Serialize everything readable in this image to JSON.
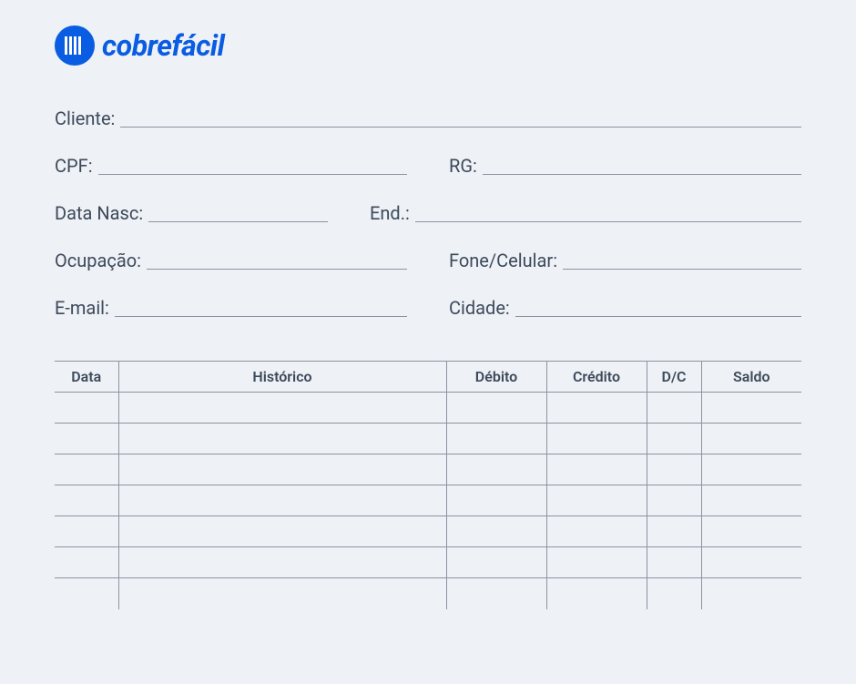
{
  "brand": {
    "name": "cobrefácil",
    "accent": "#0a5ce2"
  },
  "fields": {
    "cliente": "Cliente:",
    "cpf": "CPF:",
    "rg": "RG:",
    "data_nasc": "Data Nasc:",
    "end": "End.:",
    "ocupacao": "Ocupação:",
    "fone": "Fone/Celular:",
    "email": "E-mail:",
    "cidade": "Cidade:"
  },
  "table": {
    "headers": {
      "data": "Data",
      "historico": "Histórico",
      "debito": "Débito",
      "credito": "Crédito",
      "dc": "D/C",
      "saldo": "Saldo"
    },
    "empty_row_count": 7
  }
}
